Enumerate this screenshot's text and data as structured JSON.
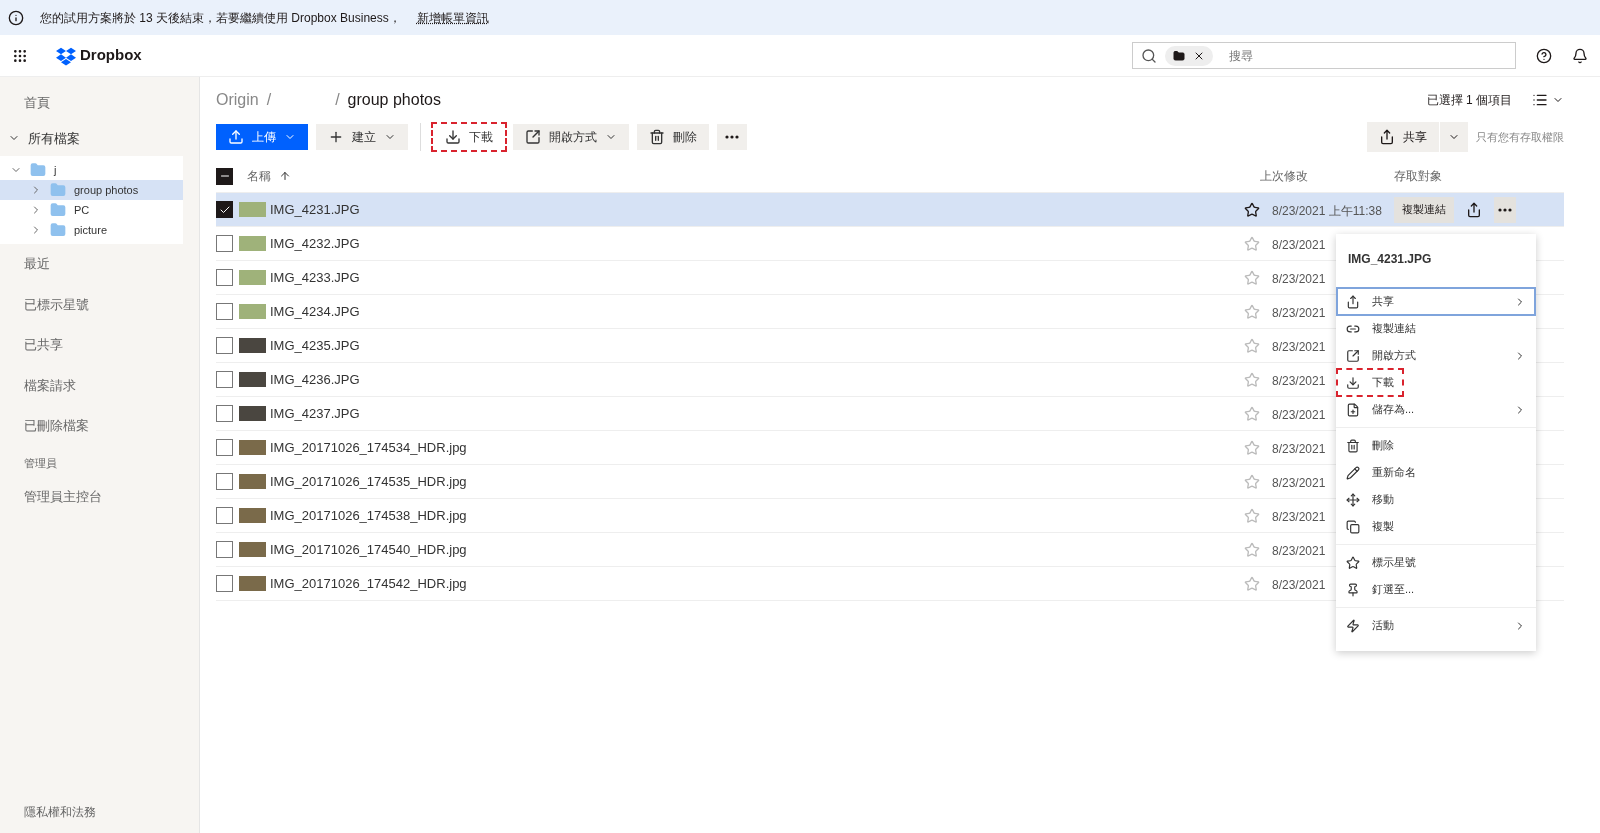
{
  "banner": {
    "text": "您的試用方案將於 13 天後結束，若要繼續使用 Dropbox Business，",
    "link": "新增帳單資訊"
  },
  "header": {
    "logo": "Dropbox",
    "search": {
      "placeholder": "搜尋"
    }
  },
  "sidebar": {
    "top": [
      {
        "label": "首頁"
      }
    ],
    "all_files": {
      "label": "所有檔案",
      "expanded": true,
      "tree": [
        {
          "label": "j",
          "expanded": true,
          "selected": false,
          "children": [
            {
              "label": "group photos",
              "expanded": false,
              "selected": true
            },
            {
              "label": "PC",
              "expanded": false,
              "selected": false
            },
            {
              "label": "picture",
              "expanded": false,
              "selected": false
            }
          ]
        }
      ]
    },
    "nav": [
      {
        "label": "最近"
      },
      {
        "label": "已標示星號"
      },
      {
        "label": "已共享"
      },
      {
        "label": "檔案請求"
      },
      {
        "label": "已刪除檔案"
      }
    ],
    "admin_heading": "管理員",
    "admin_items": [
      {
        "label": "管理員主控台"
      }
    ],
    "footer": "隱私權和法務"
  },
  "breadcrumb": {
    "items": [
      "Origin",
      "group photos"
    ],
    "separators": [
      "/",
      "/"
    ]
  },
  "toolbar": [
    {
      "label": "上傳",
      "kind": "primary",
      "caret": true,
      "highlighted": false
    },
    {
      "label": "建立",
      "kind": "secondary",
      "caret": true,
      "highlighted": false
    },
    {
      "label": "下載",
      "kind": "plain",
      "caret": false,
      "highlighted": true
    },
    {
      "label": "開啟方式",
      "kind": "secondary",
      "caret": true,
      "highlighted": false
    },
    {
      "label": "刪除",
      "kind": "secondary",
      "caret": false,
      "highlighted": false
    }
  ],
  "selection_count": "已選擇 1 個項目",
  "share": {
    "label": "共享",
    "note": "只有您有存取權限"
  },
  "table": {
    "select_all_partial": true,
    "columns": [
      "名稱",
      "上次修改",
      "存取對象"
    ],
    "rows": [
      {
        "name": "IMG_4231.JPG",
        "modified": "8/23/2021 上午11:38",
        "checked": true,
        "copy_link": "複製連結"
      },
      {
        "name": "IMG_4232.JPG",
        "modified": "8/23/2021",
        "checked": false
      },
      {
        "name": "IMG_4233.JPG",
        "modified": "8/23/2021",
        "checked": false
      },
      {
        "name": "IMG_4234.JPG",
        "modified": "8/23/2021",
        "checked": false
      },
      {
        "name": "IMG_4235.JPG",
        "modified": "8/23/2021",
        "checked": false
      },
      {
        "name": "IMG_4236.JPG",
        "modified": "8/23/2021",
        "checked": false
      },
      {
        "name": "IMG_4237.JPG",
        "modified": "8/23/2021",
        "checked": false
      },
      {
        "name": "IMG_20171026_174534_HDR.jpg",
        "modified": "8/23/2021",
        "checked": false
      },
      {
        "name": "IMG_20171026_174535_HDR.jpg",
        "modified": "8/23/2021",
        "checked": false
      },
      {
        "name": "IMG_20171026_174538_HDR.jpg",
        "modified": "8/23/2021",
        "checked": false
      },
      {
        "name": "IMG_20171026_174540_HDR.jpg",
        "modified": "8/23/2021",
        "checked": false
      },
      {
        "name": "IMG_20171026_174542_HDR.jpg",
        "modified": "8/23/2021",
        "checked": false
      }
    ]
  },
  "context_menu": {
    "title": "IMG_4231.JPG",
    "groups": [
      [
        {
          "label": "共享",
          "submenu": true,
          "focused": true,
          "highlighted": false
        },
        {
          "label": "複製連結",
          "submenu": false,
          "focused": false,
          "highlighted": false
        },
        {
          "label": "開啟方式",
          "submenu": true,
          "focused": false,
          "highlighted": false
        },
        {
          "label": "下載",
          "submenu": false,
          "focused": false,
          "highlighted": true
        },
        {
          "label": "儲存為...",
          "submenu": true,
          "focused": false,
          "highlighted": false
        }
      ],
      [
        {
          "label": "刪除",
          "submenu": false,
          "focused": false,
          "highlighted": false
        },
        {
          "label": "重新命名",
          "submenu": false,
          "focused": false,
          "highlighted": false
        },
        {
          "label": "移動",
          "submenu": false,
          "focused": false,
          "highlighted": false
        },
        {
          "label": "複製",
          "submenu": false,
          "focused": false,
          "highlighted": false
        }
      ],
      [
        {
          "label": "標示星號",
          "submenu": false,
          "focused": false,
          "highlighted": false
        },
        {
          "label": "釘選至...",
          "submenu": false,
          "focused": false,
          "highlighted": false
        }
      ],
      [
        {
          "label": "活動",
          "submenu": true,
          "focused": false,
          "highlighted": false
        }
      ]
    ]
  }
}
